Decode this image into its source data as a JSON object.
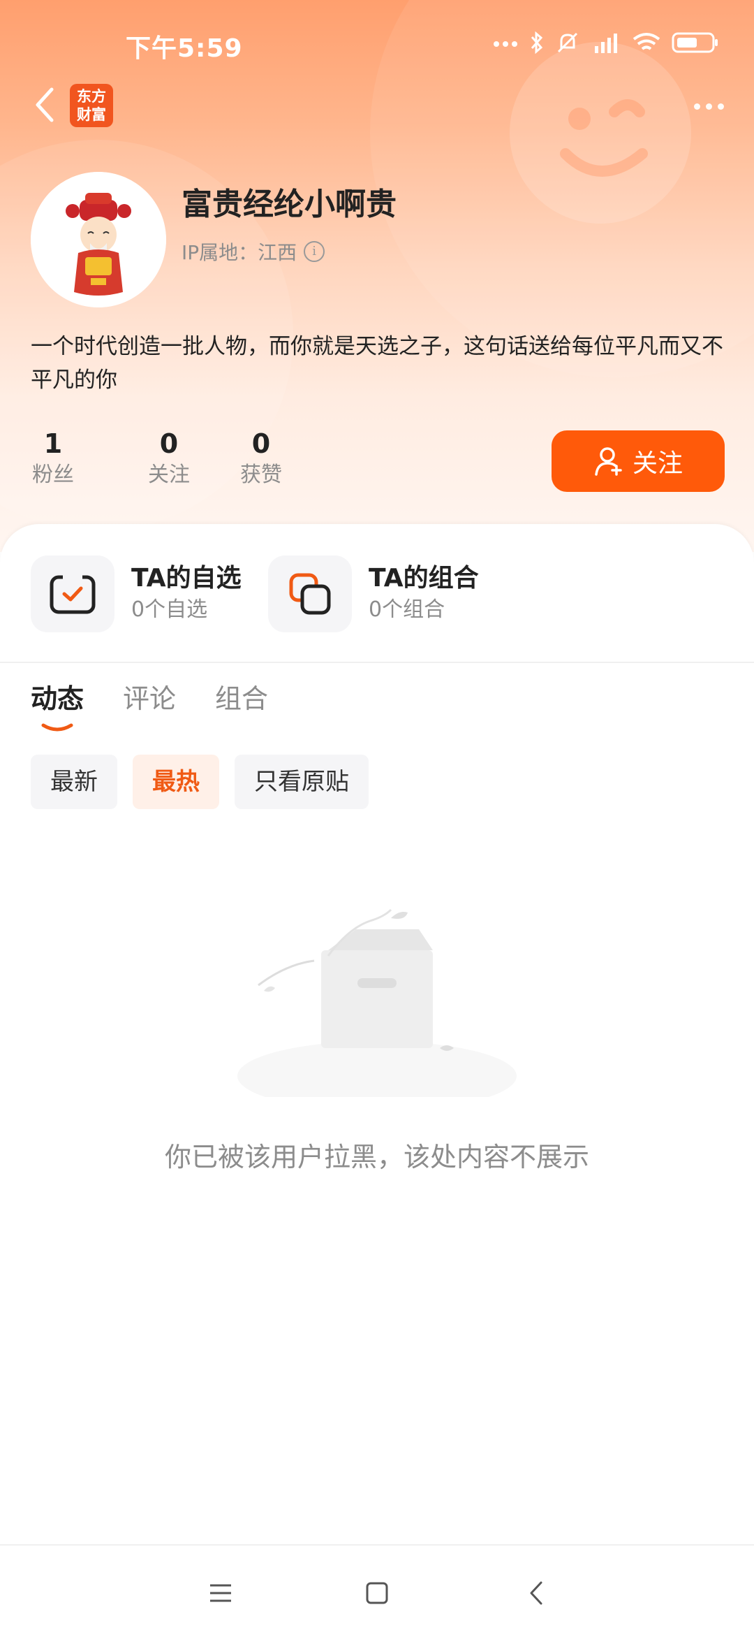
{
  "status_bar": {
    "time": "下午5:59",
    "icons": [
      "more-dots-icon",
      "bluetooth-icon",
      "mute-bell-icon",
      "signal-icon",
      "wifi-icon",
      "battery-icon"
    ]
  },
  "nav": {
    "logo_line1": "东方",
    "logo_line2": "财富"
  },
  "profile": {
    "username": "富贵经纶小啊贵",
    "ip_location": "IP属地：江西",
    "bio": "一个时代创造一批人物，而你就是天选之子，这句话送给每位平凡而又不平凡的你"
  },
  "stats": [
    {
      "value": "1",
      "label": "粉丝"
    },
    {
      "value": "0",
      "label": "关注"
    },
    {
      "value": "0",
      "label": "获赞"
    }
  ],
  "follow_button": {
    "label": "关注"
  },
  "entries": [
    {
      "title": "TA的自选",
      "sub": "0个自选"
    },
    {
      "title": "TA的组合",
      "sub": "0个组合"
    }
  ],
  "tabs": [
    {
      "label": "动态",
      "active": true
    },
    {
      "label": "评论",
      "active": false
    },
    {
      "label": "组合",
      "active": false
    }
  ],
  "filters": [
    {
      "label": "最新",
      "active": false
    },
    {
      "label": "最热",
      "active": true
    },
    {
      "label": "只看原贴",
      "active": false
    }
  ],
  "empty_state": {
    "message": "你已被该用户拉黑，该处内容不展示"
  },
  "colors": {
    "accent": "#ff5a0a",
    "accent_text": "#f05a14",
    "muted": "#8c8c8c"
  }
}
